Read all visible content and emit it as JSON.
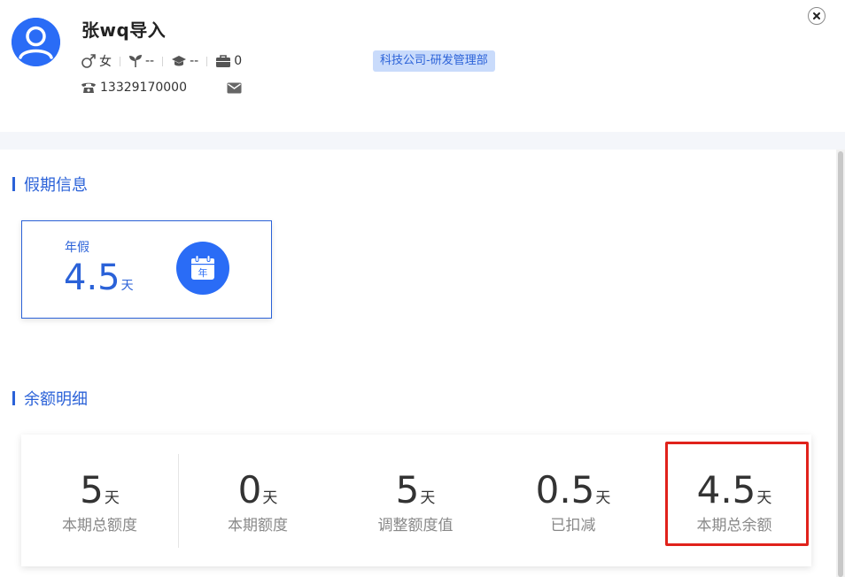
{
  "profile": {
    "name": "张wq导入",
    "gender": "女",
    "field2": "--",
    "education": "--",
    "work_years": "0",
    "phone": "13329170000",
    "department": "科技公司-研发管理部",
    "icons": {
      "avatar": "user-avatar-icon",
      "gender": "male-symbol-icon",
      "seedling": "seedling-icon",
      "education": "graduation-cap-icon",
      "work": "briefcase-icon",
      "phone": "telephone-icon",
      "mail": "envelope-icon",
      "close": "close-icon"
    }
  },
  "leave_section": {
    "title": "假期信息",
    "cards": [
      {
        "name": "年假",
        "value": "4.5",
        "unit": "天",
        "icon_text": "年"
      }
    ]
  },
  "balance_section": {
    "title": "余额明细",
    "stats": [
      {
        "value": "5",
        "unit": "天",
        "label": "本期总额度"
      },
      {
        "value": "0",
        "unit": "天",
        "label": "本期额度"
      },
      {
        "value": "5",
        "unit": "天",
        "label": "调整额度值"
      },
      {
        "value": "0.5",
        "unit": "天",
        "label": "已扣减"
      },
      {
        "value": "4.5",
        "unit": "天",
        "label": "本期总余额"
      }
    ]
  },
  "colors": {
    "accent": "#2b62d8",
    "avatar_bg": "#2a6cf6",
    "tag_bg": "#c9dbfb",
    "highlight": "#e0221b",
    "band": "#f4f6fa"
  }
}
